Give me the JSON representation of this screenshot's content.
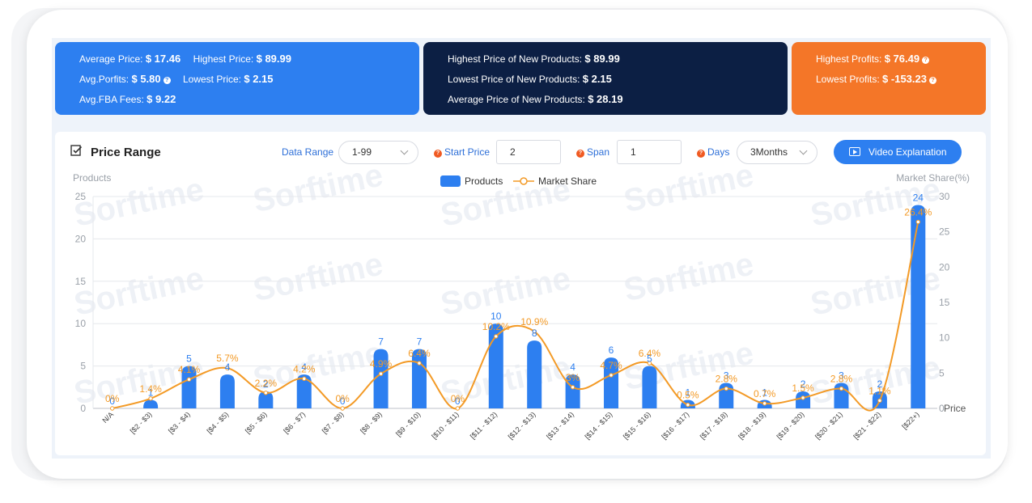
{
  "summary": {
    "avg_price_label": "Average Price:",
    "avg_price": "$ 17.46",
    "highest_price_label": "Highest Price:",
    "highest_price": "$ 89.99",
    "avg_profits_label": "Avg.Porfits:",
    "avg_profits": "$ 5.80",
    "lowest_price_label": "Lowest Price:",
    "lowest_price": "$ 2.15",
    "avg_fba_label": "Avg.FBA Fees:",
    "avg_fba": "$ 9.22"
  },
  "new_products": {
    "highest_label": "Highest Price of New Products:",
    "highest": "$ 89.99",
    "lowest_label": "Lowest Price of New Products:",
    "lowest": "$ 2.15",
    "average_label": "Average Price of New Products:",
    "average": "$ 28.19"
  },
  "profits": {
    "highest_label": "Highest Profits:",
    "highest": "$ 76.49",
    "lowest_label": "Lowest Profits:",
    "lowest": "$ -153.23"
  },
  "help_glyph": "?",
  "panel": {
    "title": "Price Range",
    "data_range_label": "Data Range",
    "data_range_value": "1-99",
    "start_price_label": "Start Price",
    "start_price_value": "2",
    "span_label": "Span",
    "span_value": "1",
    "days_label": "Days",
    "days_value": "3Months",
    "video_button": "Video Explanation"
  },
  "watermark": "Sorftime",
  "colors": {
    "bar": "#2d7ff0",
    "line": "#f39a26",
    "card_blue": "#2d7ff0",
    "card_navy": "#0c1f44",
    "card_orange": "#f47628"
  },
  "chart_data": {
    "type": "bar",
    "categories": [
      "N/A",
      "[$2 - $3)",
      "[$3 - $4)",
      "[$4 - $5)",
      "[$5 - $6)",
      "[$6 - $7)",
      "[$7 - $8)",
      "[$8 - $9)",
      "[$9 - $10)",
      "[$10 - $11)",
      "[$11 - $12)",
      "[$12 - $13)",
      "[$13 - $14)",
      "[$14 - $15)",
      "[$15 - $16)",
      "[$16 - $17)",
      "[$17 - $18)",
      "[$18 - $19)",
      "[$19 - $20)",
      "[$20 - $21)",
      "[$21 - $22)",
      "[$22+)"
    ],
    "series": [
      {
        "name": "Products",
        "type": "bar",
        "axis": "left",
        "values": [
          0,
          1,
          5,
          4,
          2,
          4,
          0,
          7,
          7,
          0,
          10,
          8,
          4,
          6,
          5,
          1,
          3,
          1,
          2,
          3,
          2,
          24
        ],
        "labels": [
          "0",
          "1",
          "5",
          "4",
          "2",
          "4",
          "0",
          "7",
          "7",
          "0",
          "10",
          "8",
          "4",
          "6",
          "5",
          "1",
          "3",
          "1",
          "2",
          "3",
          "2",
          "24"
        ]
      },
      {
        "name": "Market Share",
        "type": "line",
        "axis": "right",
        "values": [
          0,
          1.4,
          4.1,
          5.7,
          2.2,
          4.2,
          0,
          4.9,
          6.4,
          0,
          10.2,
          10.9,
          3,
          4.7,
          6.4,
          0.5,
          2.8,
          0.7,
          1.5,
          2.8,
          1.1,
          26.4
        ],
        "labels": [
          "0%",
          "1.4%",
          "4.1%",
          "5.7%",
          "2.2%",
          "4.2%",
          "0%",
          "4.9%",
          "6.4%",
          "0%",
          "10.2%",
          "10.9%",
          "3%",
          "4.7%",
          "6.4%",
          "0.5%",
          "2.8%",
          "0.7%",
          "1.5%",
          "2.8%",
          "1.1%",
          "26.4%"
        ]
      }
    ],
    "ylabel": "Products",
    "y2label": "Market Share(%)",
    "xlabel": "Price",
    "ylim": [
      0,
      25
    ],
    "y2lim": [
      0,
      30
    ],
    "yticks": [
      "0",
      "5",
      "10",
      "15",
      "20",
      "25"
    ],
    "y2ticks": [
      "0",
      "5",
      "10",
      "15",
      "20",
      "25",
      "30"
    ],
    "grid": true,
    "legend": "top-center"
  }
}
